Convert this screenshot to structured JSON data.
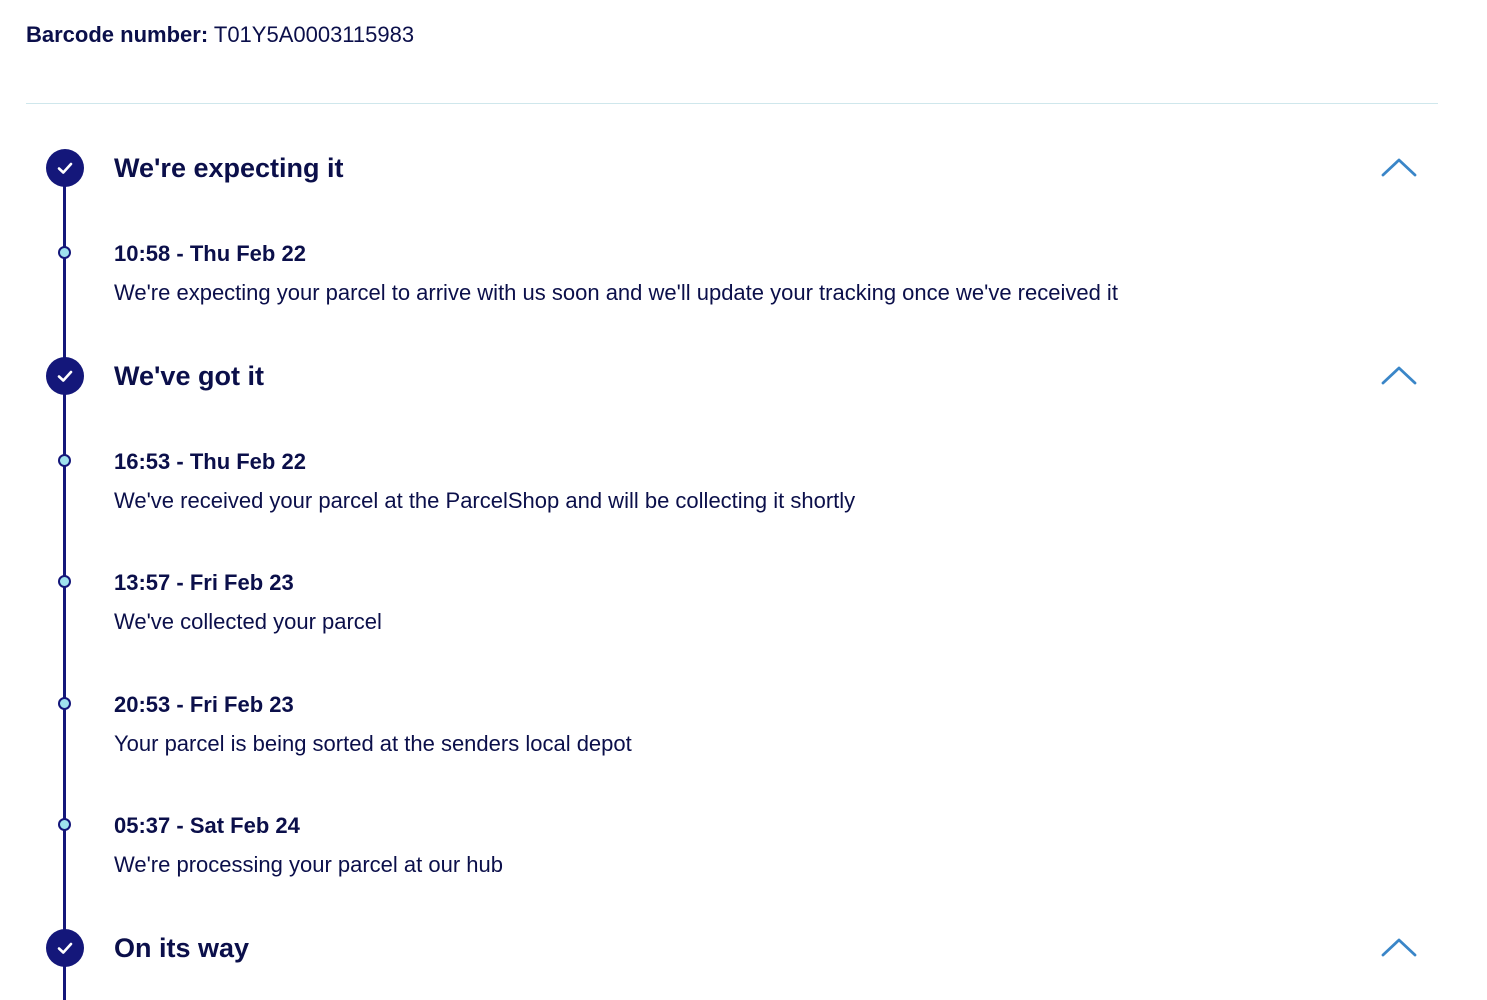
{
  "barcode": {
    "label": "Barcode number:",
    "value": "T01Y5A0003115983"
  },
  "colors": {
    "primary": "#14177a",
    "text": "#0b0f4a",
    "accent": "#3a86c8",
    "dot_fill": "#9fe2ee",
    "divider": "#cfe7ec"
  },
  "stages": [
    {
      "title": "We're expecting it",
      "expanded": true,
      "completed": true,
      "events": [
        {
          "time": "10:58 - Thu Feb 22",
          "description": "We're expecting your parcel to arrive with us soon and we'll update your tracking once we've received it"
        }
      ]
    },
    {
      "title": "We've got it",
      "expanded": true,
      "completed": true,
      "events": [
        {
          "time": "16:53 - Thu Feb 22",
          "description": "We've received your parcel at the ParcelShop and will be collecting it shortly"
        },
        {
          "time": "13:57 - Fri Feb 23",
          "description": "We've collected your parcel"
        },
        {
          "time": "20:53 - Fri Feb 23",
          "description": "Your parcel is being sorted at the senders local depot"
        },
        {
          "time": "05:37 - Sat Feb 24",
          "description": "We're processing your parcel at our hub"
        }
      ]
    },
    {
      "title": "On its way",
      "expanded": true,
      "completed": true,
      "events": []
    }
  ],
  "icons": {
    "stage_status": "check-circle-icon",
    "toggle": "chevron-up-icon",
    "event_marker": "timeline-dot-icon"
  }
}
